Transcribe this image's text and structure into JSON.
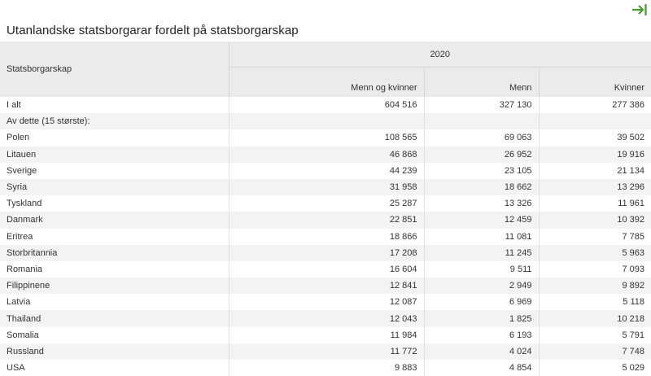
{
  "title": "Utanlandske statsborgarar fordelt på statsborgarskap",
  "accent_color": "#4a9a2f",
  "expand_icon": "arrow-to-right-icon",
  "table": {
    "stub_header": "Statsborgarskap",
    "year": "2020",
    "columns": [
      "Menn og kvinner",
      "Menn",
      "Kvinner"
    ],
    "rows": [
      {
        "label": "I alt",
        "values": [
          "604 516",
          "327 130",
          "277 386"
        ]
      },
      {
        "label": "Av dette (15 største):",
        "values": [
          "",
          "",
          ""
        ]
      },
      {
        "label": "Polen",
        "values": [
          "108 565",
          "69 063",
          "39 502"
        ]
      },
      {
        "label": "Litauen",
        "values": [
          "46 868",
          "26 952",
          "19 916"
        ]
      },
      {
        "label": "Sverige",
        "values": [
          "44 239",
          "23 105",
          "21 134"
        ]
      },
      {
        "label": "Syria",
        "values": [
          "31 958",
          "18 662",
          "13 296"
        ]
      },
      {
        "label": "Tyskland",
        "values": [
          "25 287",
          "13 326",
          "11 961"
        ]
      },
      {
        "label": "Danmark",
        "values": [
          "22 851",
          "12 459",
          "10 392"
        ]
      },
      {
        "label": "Eritrea",
        "values": [
          "18 866",
          "11 081",
          "7 785"
        ]
      },
      {
        "label": "Storbritannia",
        "values": [
          "17 208",
          "11 245",
          "5 963"
        ]
      },
      {
        "label": "Romania",
        "values": [
          "16 604",
          "9 511",
          "7 093"
        ]
      },
      {
        "label": "Filippinene",
        "values": [
          "12 841",
          "2 949",
          "9 892"
        ]
      },
      {
        "label": "Latvia",
        "values": [
          "12 087",
          "6 969",
          "5 118"
        ]
      },
      {
        "label": "Thailand",
        "values": [
          "12 043",
          "1 825",
          "10 218"
        ]
      },
      {
        "label": "Somalia",
        "values": [
          "11 984",
          "6 193",
          "5 791"
        ]
      },
      {
        "label": "Russland",
        "values": [
          "11 772",
          "4 024",
          "7 748"
        ]
      },
      {
        "label": "USA",
        "values": [
          "9 883",
          "4 854",
          "5 029"
        ]
      }
    ]
  }
}
